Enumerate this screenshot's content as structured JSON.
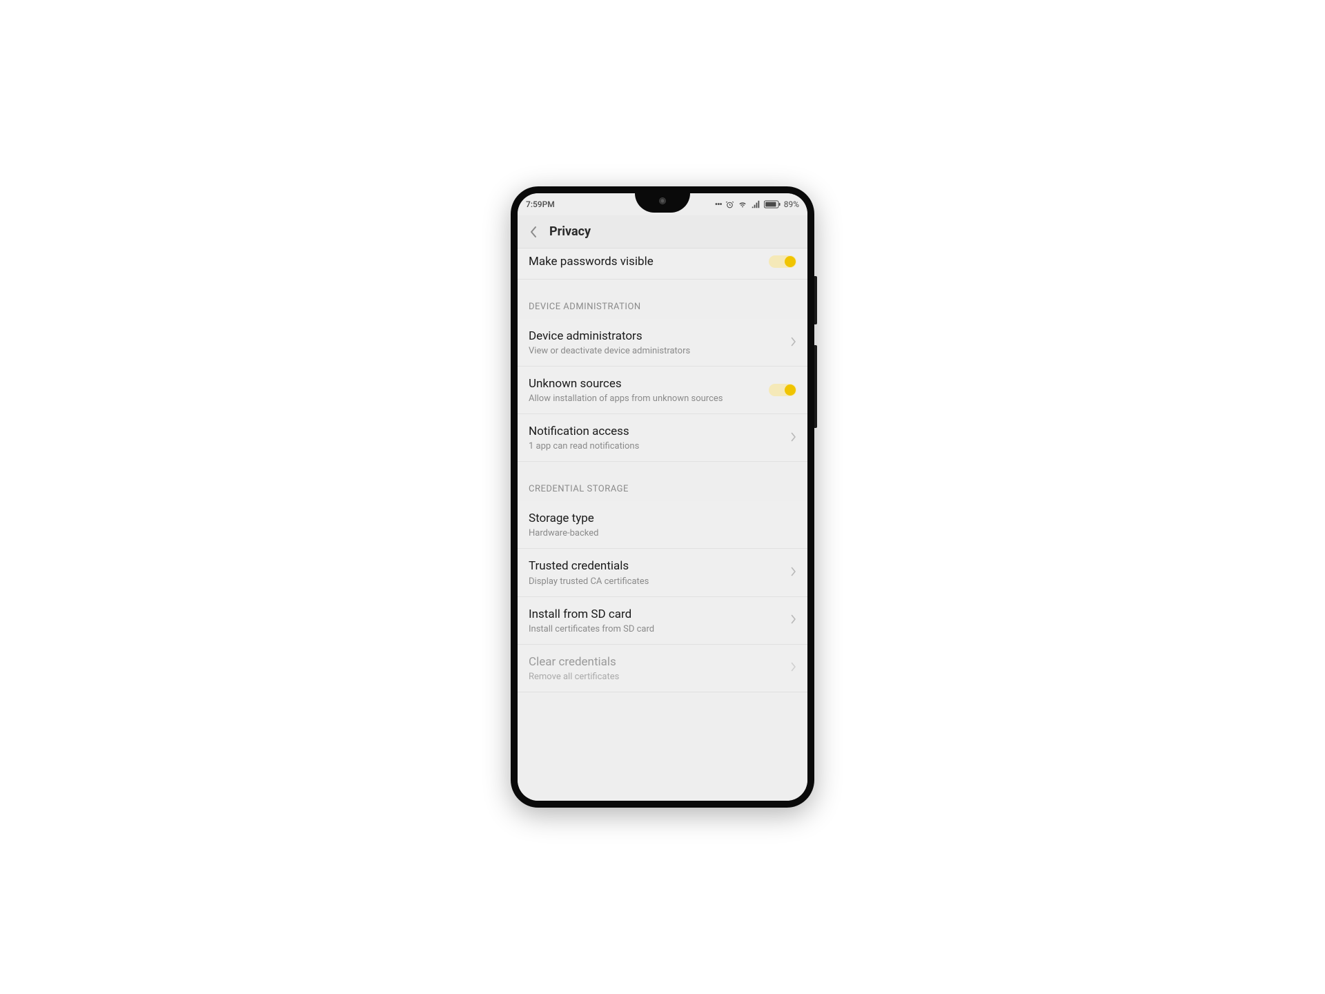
{
  "status_bar": {
    "time": "7:59PM",
    "battery_percent": "89%"
  },
  "header": {
    "title": "Privacy"
  },
  "top_item": {
    "title": "Make passwords visible"
  },
  "sections": [
    {
      "header": "DEVICE ADMINISTRATION",
      "items": [
        {
          "title": "Device administrators",
          "subtitle": "View or deactivate device administrators",
          "type": "nav"
        },
        {
          "title": "Unknown sources",
          "subtitle": "Allow installation of apps from unknown sources",
          "type": "toggle"
        },
        {
          "title": "Notification access",
          "subtitle": "1 app can read notifications",
          "type": "nav"
        }
      ]
    },
    {
      "header": "CREDENTIAL STORAGE",
      "items": [
        {
          "title": "Storage type",
          "subtitle": "Hardware-backed",
          "type": "plain"
        },
        {
          "title": "Trusted credentials",
          "subtitle": "Display trusted CA certificates",
          "type": "nav"
        },
        {
          "title": "Install from SD card",
          "subtitle": "Install certificates from SD card",
          "type": "nav"
        },
        {
          "title": "Clear credentials",
          "subtitle": "Remove all certificates",
          "type": "nav",
          "disabled": true
        }
      ]
    }
  ]
}
